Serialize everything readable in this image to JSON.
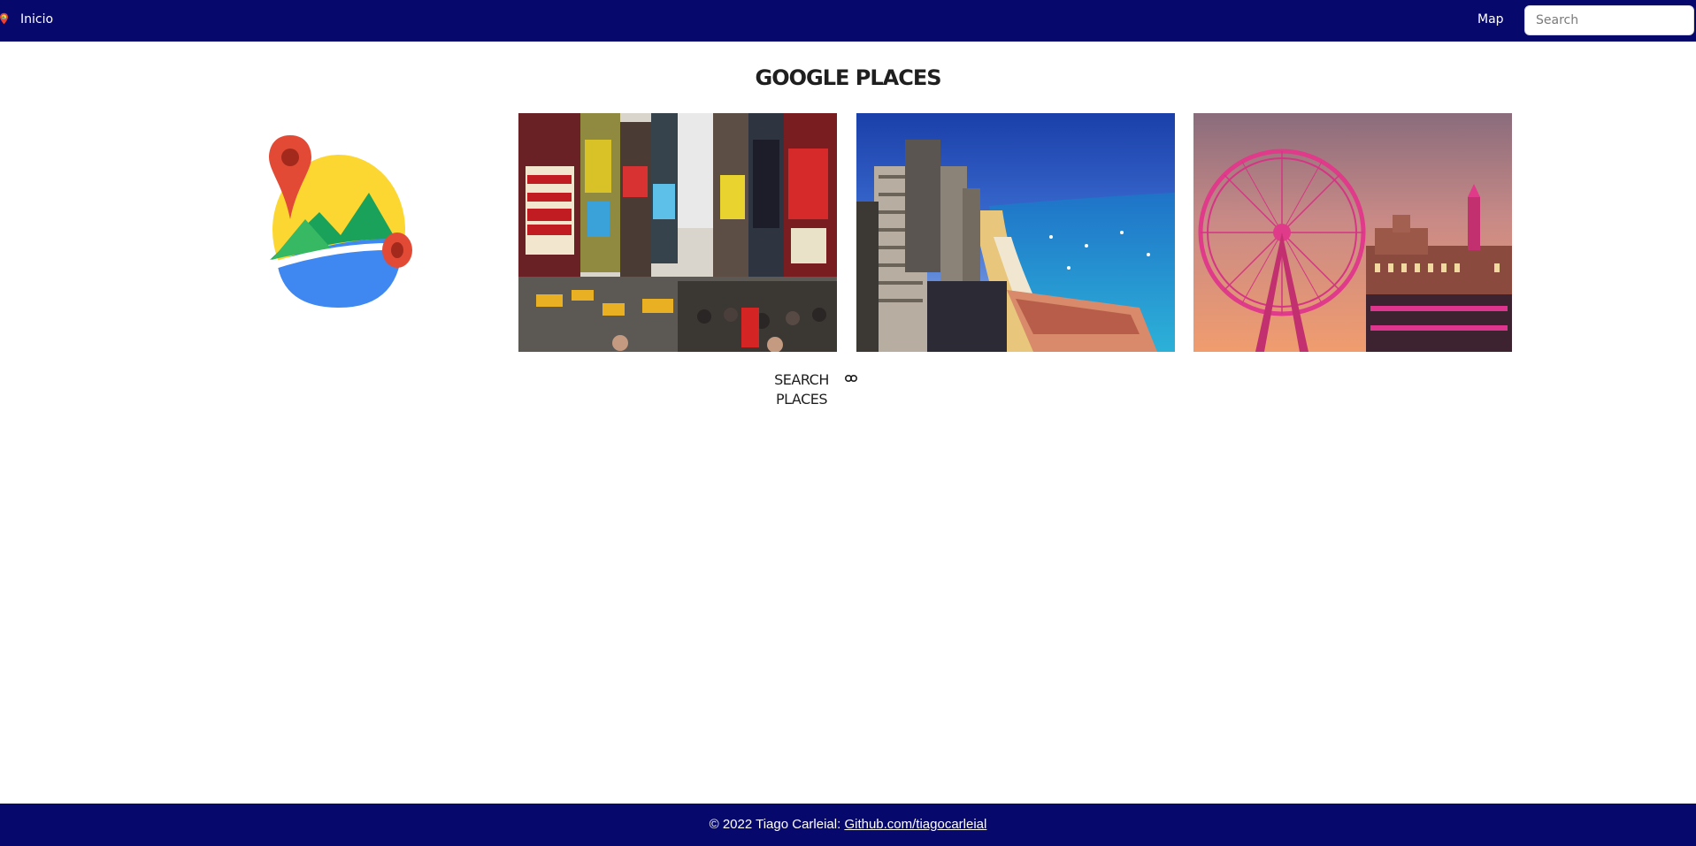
{
  "navbar": {
    "logo_icon": "map-pin-icon",
    "home_label": "Inicio",
    "map_label": "Map",
    "search_placeholder": "Search",
    "background_color": "#06086b"
  },
  "main": {
    "title": "GOOGLE PLACES",
    "logo_icon": "google-photos-places-logo",
    "photos": [
      {
        "name": "times-square-photo"
      },
      {
        "name": "coastal-city-photo"
      },
      {
        "name": "london-eye-photo"
      }
    ],
    "search_places_label": "SEARCH PLACES",
    "search_places_icon": "link-icon"
  },
  "footer": {
    "copyright_text": "© 2022 Tiago Carleial: ",
    "link_label": "Github.com/tiagocarleial",
    "background_color": "#06086b"
  }
}
